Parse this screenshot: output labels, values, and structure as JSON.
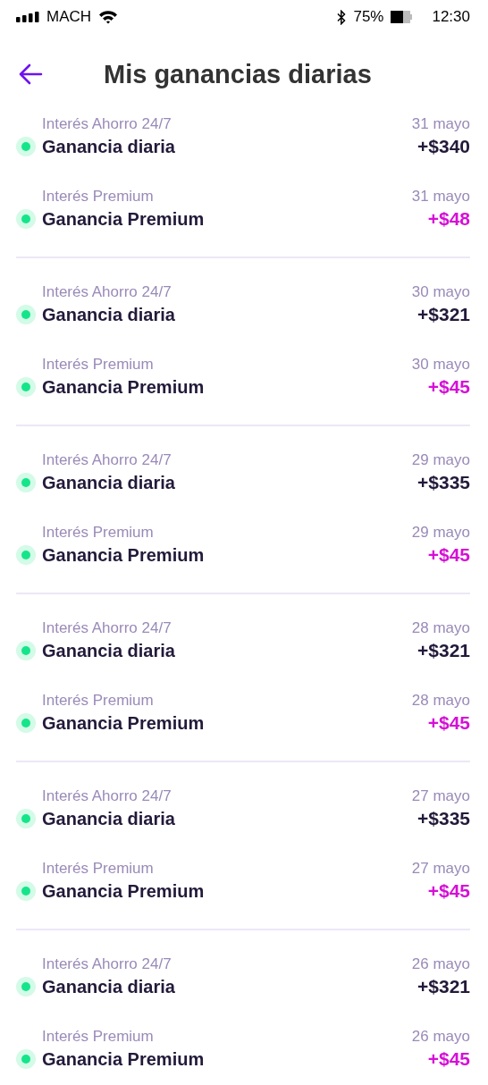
{
  "status_bar": {
    "carrier": "MACH",
    "battery_percent": "75%",
    "time": "12:30"
  },
  "header": {
    "title": "Mis ganancias diarias"
  },
  "groups": [
    {
      "items": [
        {
          "kind": "daily",
          "label": "Interés Ahorro 24/7",
          "title": "Ganancia diaria",
          "date": "31 mayo",
          "amount": "+$340"
        },
        {
          "kind": "premium",
          "label": "Interés Premium",
          "title": "Ganancia Premium",
          "date": "31 mayo",
          "amount": "+$48"
        }
      ]
    },
    {
      "items": [
        {
          "kind": "daily",
          "label": "Interés Ahorro 24/7",
          "title": "Ganancia diaria",
          "date": "30 mayo",
          "amount": "+$321"
        },
        {
          "kind": "premium",
          "label": "Interés Premium",
          "title": "Ganancia Premium",
          "date": "30 mayo",
          "amount": "+$45"
        }
      ]
    },
    {
      "items": [
        {
          "kind": "daily",
          "label": "Interés Ahorro 24/7",
          "title": "Ganancia diaria",
          "date": "29 mayo",
          "amount": "+$335"
        },
        {
          "kind": "premium",
          "label": "Interés Premium",
          "title": "Ganancia Premium",
          "date": "29 mayo",
          "amount": "+$45"
        }
      ]
    },
    {
      "items": [
        {
          "kind": "daily",
          "label": "Interés Ahorro 24/7",
          "title": "Ganancia diaria",
          "date": "28 mayo",
          "amount": "+$321"
        },
        {
          "kind": "premium",
          "label": "Interés Premium",
          "title": "Ganancia Premium",
          "date": "28 mayo",
          "amount": "+$45"
        }
      ]
    },
    {
      "items": [
        {
          "kind": "daily",
          "label": "Interés Ahorro 24/7",
          "title": "Ganancia diaria",
          "date": "27 mayo",
          "amount": "+$335"
        },
        {
          "kind": "premium",
          "label": "Interés Premium",
          "title": "Ganancia Premium",
          "date": "27 mayo",
          "amount": "+$45"
        }
      ]
    },
    {
      "items": [
        {
          "kind": "daily",
          "label": "Interés Ahorro 24/7",
          "title": "Ganancia diaria",
          "date": "26 mayo",
          "amount": "+$321"
        },
        {
          "kind": "premium",
          "label": "Interés Premium",
          "title": "Ganancia Premium",
          "date": "26 mayo",
          "amount": "+$45"
        }
      ]
    }
  ]
}
